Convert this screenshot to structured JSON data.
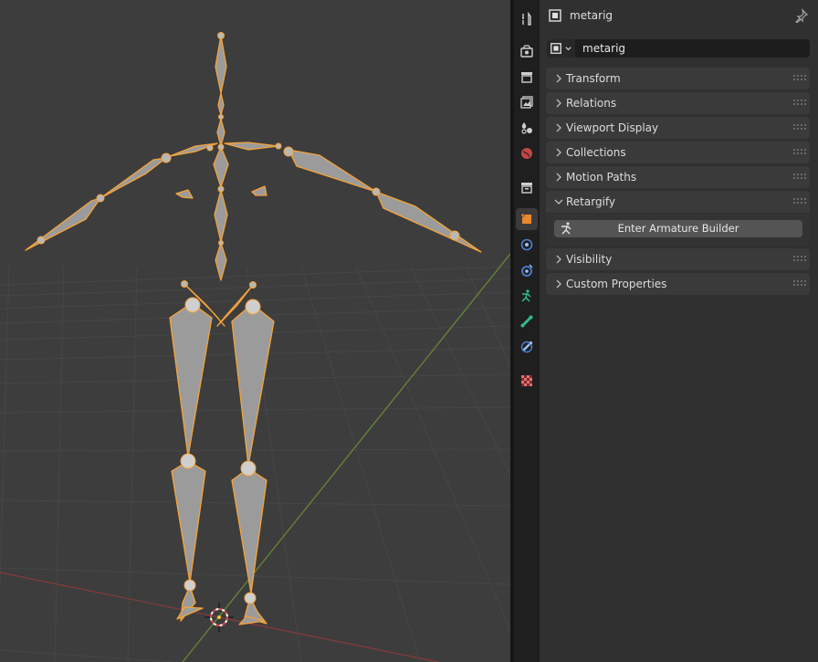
{
  "properties": {
    "header": {
      "object_name": "metarig",
      "object_icon": "object-data-icon",
      "pin_icon": "pin-icon"
    },
    "name_field": {
      "value": "metarig",
      "type_icon": "object-data-icon"
    },
    "panels": [
      {
        "label": "Transform",
        "expanded": false
      },
      {
        "label": "Relations",
        "expanded": false
      },
      {
        "label": "Viewport Display",
        "expanded": false
      },
      {
        "label": "Collections",
        "expanded": false
      },
      {
        "label": "Motion Paths",
        "expanded": false
      },
      {
        "label": "Retargify",
        "expanded": true,
        "button_label": "Enter Armature Builder",
        "button_icon": "armature-pose-icon"
      },
      {
        "label": "Visibility",
        "expanded": false
      },
      {
        "label": "Custom Properties",
        "expanded": false
      }
    ]
  },
  "tabs": [
    {
      "name": "tool-icon"
    },
    {
      "name": "render-icon"
    },
    {
      "name": "output-icon"
    },
    {
      "name": "view-layer-icon"
    },
    {
      "name": "scene-icon"
    },
    {
      "name": "world-icon"
    },
    {
      "name": "collection-icon"
    },
    {
      "name": "object-icon",
      "active": true
    },
    {
      "name": "modifier-icon"
    },
    {
      "name": "physics-icon"
    },
    {
      "name": "object-data-armature-icon"
    },
    {
      "name": "bone-icon"
    },
    {
      "name": "bone-constraint-icon"
    },
    {
      "name": "texture-icon"
    }
  ],
  "colors": {
    "selection": "#f5a33a",
    "bone": "#9a9a9a",
    "x_axis": "#8a3a3a",
    "y_axis": "#6b8a33",
    "viewport_bg": "#3d3d3d",
    "panel_bg": "#303030"
  }
}
